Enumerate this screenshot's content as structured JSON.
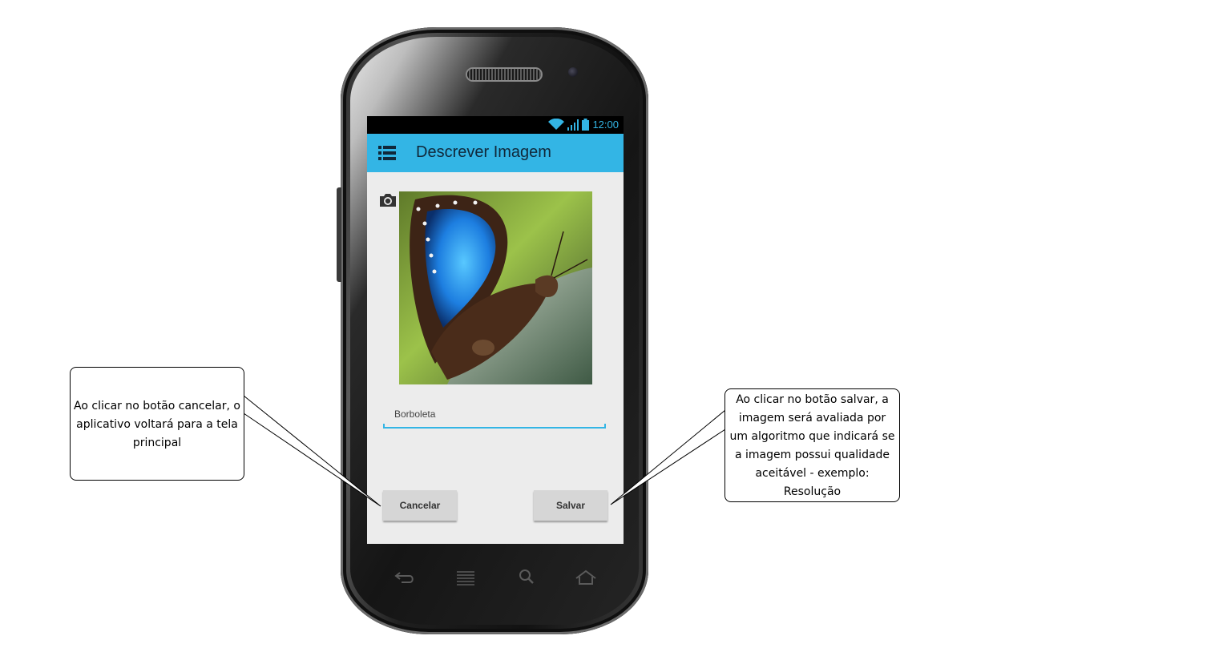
{
  "status_bar": {
    "time": "12:00",
    "wifi_icon": "wifi-icon",
    "signal_icon": "signal-icon",
    "battery_icon": "battery-icon"
  },
  "action_bar": {
    "menu_icon": "menu-list-icon",
    "title": "Descrever Imagem",
    "color": "#33b5e5"
  },
  "content": {
    "camera_icon": "camera-icon",
    "image": "butterfly-photo",
    "description_value": "Borboleta"
  },
  "buttons": {
    "cancel_label": "Cancelar",
    "save_label": "Salvar"
  },
  "nav_keys": [
    "back-icon",
    "menu-icon",
    "search-icon",
    "home-icon"
  ],
  "annotations": {
    "cancel": "Ao clicar no botão cancelar, o aplicativo voltará para a tela principal",
    "save": "Ao clicar no botão salvar, a imagem será avaliada por um algoritmo que indicará se a imagem possui qualidade aceitável - exemplo: Resolução"
  }
}
